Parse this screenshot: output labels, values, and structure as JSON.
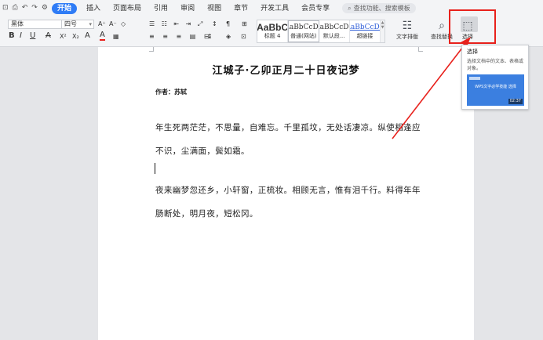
{
  "menubar": {
    "quick_access": [
      "⊡",
      "⎙",
      "↶",
      "↷",
      "⚙"
    ],
    "tabs": [
      {
        "label": "开始",
        "active": true
      },
      {
        "label": "插入"
      },
      {
        "label": "页面布局"
      },
      {
        "label": "引用"
      },
      {
        "label": "审阅"
      },
      {
        "label": "视图"
      },
      {
        "label": "章节"
      },
      {
        "label": "开发工具"
      },
      {
        "label": "会员专享"
      }
    ],
    "search_placeholder": "查找功能、搜索模板"
  },
  "ribbon": {
    "font_name": "黑体",
    "font_size": "四号",
    "format_buttons": [
      "B",
      "I",
      "U",
      "A",
      "X²",
      "X₂",
      "A",
      "A"
    ],
    "styles": [
      {
        "sample": "AaBbC",
        "name": "标题 4"
      },
      {
        "sample": "AaBbCcDd",
        "name": "普通(网站)"
      },
      {
        "sample": "AaBbCcDd",
        "name": "默认段..."
      },
      {
        "sample": "AaBbCcDd",
        "name": "超链接"
      }
    ],
    "text_layout_label": "文字排版",
    "find_replace_label": "查找替换",
    "select_label": "选择"
  },
  "tooltip": {
    "title": "选择",
    "description": "选择文档中的文本、表格或对象。",
    "video_caption": "WPS文字必学技能 选择",
    "duration": "02:37"
  },
  "document": {
    "title": "江城子·乙卯正月二十日夜记梦",
    "author": "作者：苏轼",
    "paragraph1": "年生死两茫茫，不思量，自难忘。千里孤坟，无处话凄凉。纵使相逢应不识，尘满面，鬓如霜。",
    "paragraph2": "夜来幽梦忽还乡，小轩窗，正梳妆。相顾无言，惟有泪千行。料得年年肠断处，明月夜，短松冈。"
  },
  "colors": {
    "accent": "#2f7cf6",
    "highlight_box": "#e8211c",
    "arrow": "#e8211c"
  }
}
